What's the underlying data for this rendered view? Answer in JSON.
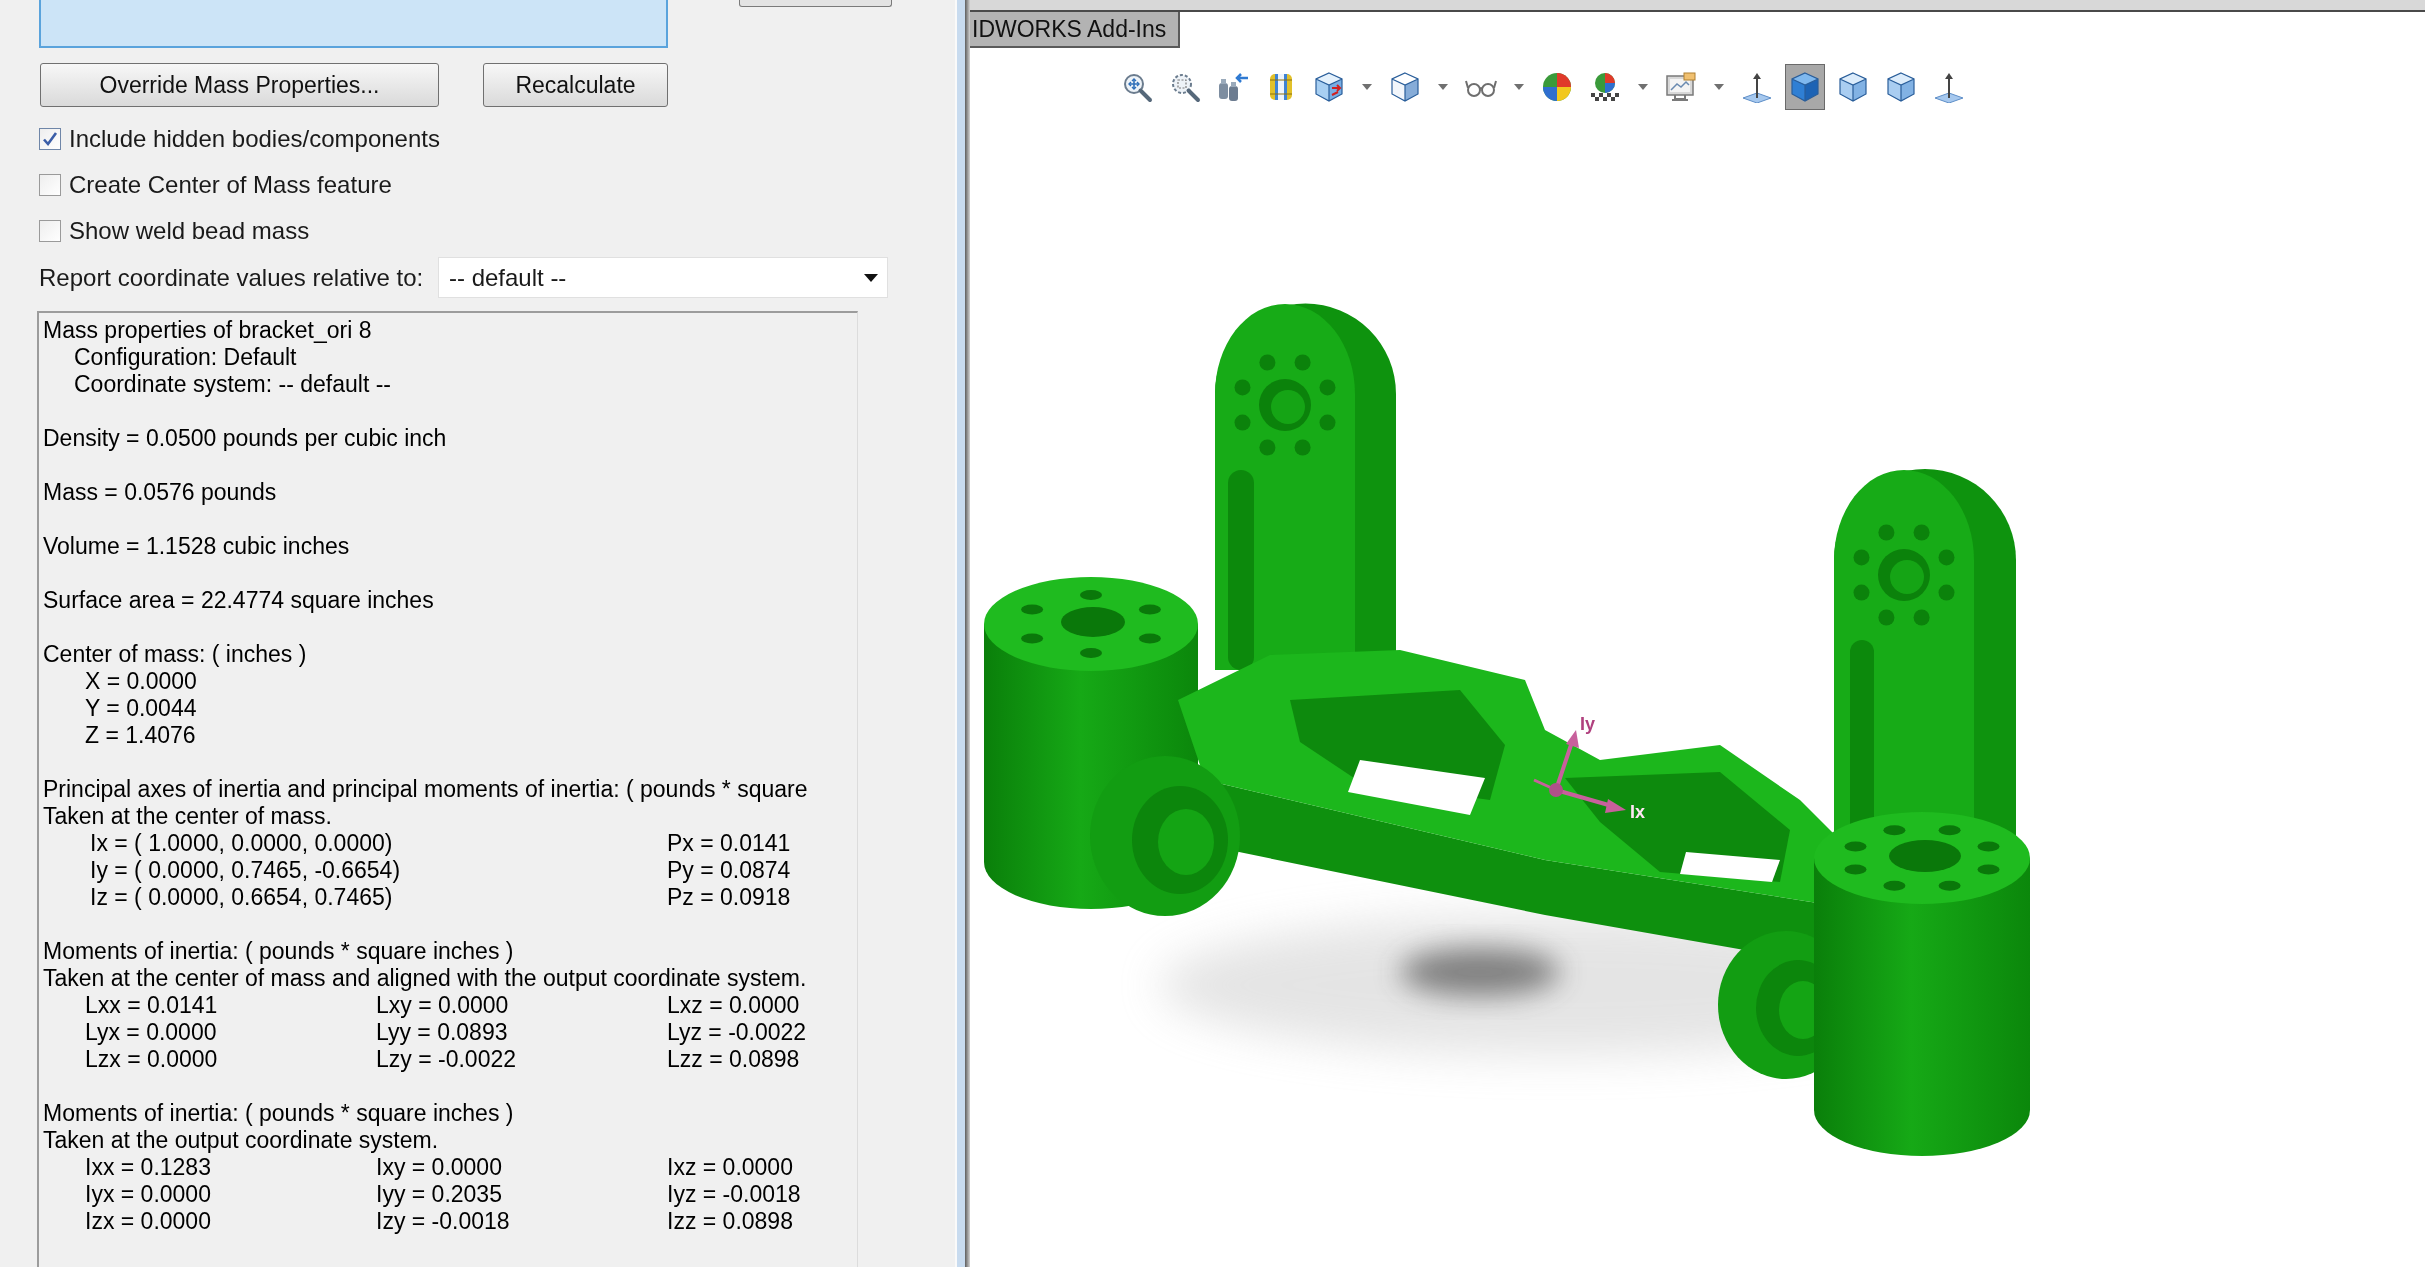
{
  "buttons": [
    {
      "label": "Override Mass Properties..."
    },
    {
      "label": "Recalculate"
    }
  ],
  "options": [
    {
      "label": "Include hidden bodies/components",
      "checked": true
    },
    {
      "label": "Create Center of Mass feature",
      "checked": false
    },
    {
      "label": "Show weld bead mass",
      "checked": false
    }
  ],
  "coordinate_reference": {
    "label": "Report coordinate values relative to:",
    "value": "-- default --"
  },
  "report": {
    "sections": [
      {
        "kind": "title",
        "heading": "Mass properties of bracket_ori 8",
        "children": [
          "Configuration: Default",
          "Coordinate system: -- default --"
        ]
      },
      {
        "kind": "line",
        "heading": "Density = 0.0500 pounds per cubic inch"
      },
      {
        "kind": "line",
        "heading": "Mass = 0.0576 pounds"
      },
      {
        "kind": "line",
        "heading": "Volume = 1.1528 cubic inches"
      },
      {
        "kind": "line",
        "heading": "Surface area = 22.4774 square inches"
      },
      {
        "kind": "list",
        "heading": "Center of mass: ( inches )",
        "children": [
          "X = 0.0000",
          "Y = 0.0044",
          "Z = 1.4076"
        ]
      },
      {
        "kind": "principal",
        "heading": "Principal axes of inertia and principal moments of inertia: ( pounds * square",
        "note": "Taken at the center of mass.",
        "rows": [
          {
            "axis": "Ix = ( 1.0000, 0.0000, 0.0000)",
            "moment": "Px = 0.0141"
          },
          {
            "axis": "Iy = ( 0.0000, 0.7465, -0.6654)",
            "moment": "Py = 0.0874"
          },
          {
            "axis": "Iz = ( 0.0000, 0.6654, 0.7465)",
            "moment": "Pz = 0.0918"
          }
        ]
      },
      {
        "kind": "matrix",
        "heading": "Moments of inertia: ( pounds * square inches )",
        "note": "Taken at the center of mass and aligned with the output coordinate system.",
        "rows": [
          [
            "Lxx = 0.0141",
            "Lxy = 0.0000",
            "Lxz = 0.0000"
          ],
          [
            "Lyx = 0.0000",
            "Lyy = 0.0893",
            "Lyz = -0.0022"
          ],
          [
            "Lzx = 0.0000",
            "Lzy = -0.0022",
            "Lzz = 0.0898"
          ]
        ]
      },
      {
        "kind": "matrix",
        "heading": "Moments of inertia: ( pounds * square inches )",
        "note": "Taken at the output coordinate system.",
        "rows": [
          [
            "Ixx = 0.1283",
            "Ixy = 0.0000",
            "Ixz = 0.0000"
          ],
          [
            "Iyx = 0.0000",
            "Iyy = 0.2035",
            "Iyz = -0.0018"
          ],
          [
            "Izx = 0.0000",
            "Izy = -0.0018",
            "Izz = 0.0898"
          ]
        ]
      }
    ]
  },
  "command_tab": {
    "label": "IDWORKS Add-Ins"
  },
  "toolbar": {
    "buttons": [
      {
        "kind": "zoomfit",
        "selected": false,
        "dropdown": false
      },
      {
        "kind": "zoomarea",
        "selected": false,
        "dropdown": false
      },
      {
        "kind": "previous",
        "selected": false,
        "dropdown": false
      },
      {
        "kind": "section",
        "selected": false,
        "dropdown": false
      },
      {
        "kind": "orientation",
        "selected": false,
        "dropdown": true
      },
      {
        "kind": "display",
        "selected": false,
        "dropdown": true
      },
      {
        "kind": "hide",
        "selected": false,
        "dropdown": true
      },
      {
        "kind": "appearance",
        "selected": false,
        "dropdown": false
      },
      {
        "kind": "scene",
        "selected": false,
        "dropdown": true
      },
      {
        "kind": "settings",
        "selected": false,
        "dropdown": true
      },
      {
        "kind": "triad",
        "selected": false,
        "dropdown": false
      },
      {
        "kind": "cube",
        "selected": true,
        "dropdown": false
      },
      {
        "kind": "cube",
        "selected": false,
        "dropdown": false
      },
      {
        "kind": "cube",
        "selected": false,
        "dropdown": false
      },
      {
        "kind": "triad",
        "selected": false,
        "dropdown": false
      }
    ]
  },
  "viewport": {
    "triad_labels": [
      "Iy",
      "Ix"
    ]
  }
}
